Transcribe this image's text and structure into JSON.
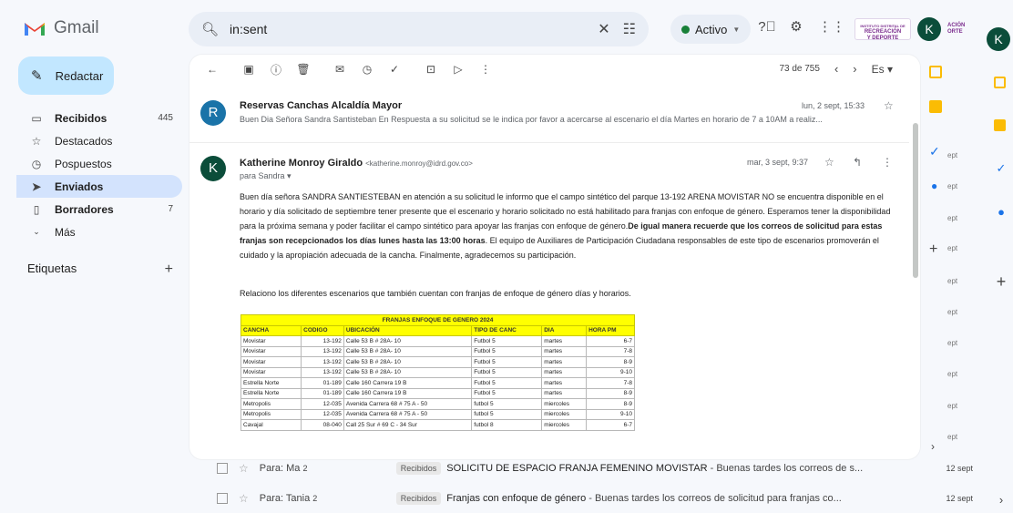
{
  "app": {
    "name": "Gmail"
  },
  "search": {
    "query": "in:sent"
  },
  "status": {
    "label": "Activo"
  },
  "org_logo": {
    "line1": "INSTITUTO DISTRITAL DE",
    "line2": "RECREACIÓN",
    "line3": "Y DEPORTE",
    "line3b": "ACIÓN",
    "line3c": "ORTE"
  },
  "account": {
    "initial": "K"
  },
  "compose": {
    "label": "Redactar"
  },
  "sidebar": {
    "items": [
      {
        "label": "Recibidos",
        "count": "445"
      },
      {
        "label": "Destacados",
        "count": ""
      },
      {
        "label": "Pospuestos",
        "count": ""
      },
      {
        "label": "Enviados",
        "count": ""
      },
      {
        "label": "Borradores",
        "count": "7"
      },
      {
        "label": "Más",
        "count": ""
      }
    ],
    "labels_title": "Etiquetas"
  },
  "toolbar": {
    "pager": "73 de 755",
    "lang": "Es"
  },
  "messages": [
    {
      "avatar": "R",
      "sender": "Reservas Canchas Alcaldía Mayor",
      "date": "lun, 2 sept, 15:33",
      "snippet": "Buen Dia Señora Sandra Santisteban En Respuesta a su solicitud se le indica por favor a acercarse al escenario el día Martes en horario de 7 a 10AM a realiz..."
    },
    {
      "avatar": "K",
      "sender": "Katherine Monroy Giraldo",
      "address": "<katherine.monroy@idrd.gov.co>",
      "to": "para Sandra",
      "date": "mar, 3 sept, 9:37"
    }
  ],
  "body": {
    "p1a": "Buen día señora SANDRA SANTIESTEBAN en atención a su solicitud le informo que el campo sintético del parque 13-192  ARENA MOVISTAR  NO se encuentra disponible en el horario y día solicitado de septiembre tener presente que el escenario y horario solicitado no está habilitado para  franjas con enfoque de género.   Esperamos tener la disponibilidad para la próxima semana y poder  facilitar el campo sintético  para apoyar  las franjas con enfoque de género.",
    "p1b": "De igual manera recuerde  que los correos de solicitud para estas franjas son recepcionados los días lunes hasta las 13:00 horas",
    "p1c": ". El equipo de Auxiliares de Participación Ciudadana responsables de este tipo de escenarios  promoverán el cuidado y la apropiación adecuada de la cancha. Finalmente, agradecemos su participación.",
    "p2": "Relaciono los diferentes escenarios que también cuentan con franjas de enfoque de género  días y horarios."
  },
  "table": {
    "title": "FRANJAS ENFOQUE DE GENERO 2024",
    "headers": [
      "CANCHA",
      "CODIGO",
      "UBICACIÓN",
      "TIPO DE CANC",
      "DIA",
      "HORA PM"
    ],
    "rows": [
      [
        "Movistar",
        "13-192",
        "Calle 53 B # 28A- 10",
        "Futbol 5",
        "martes",
        "6-7"
      ],
      [
        "Movistar",
        "13-192",
        "Calle 53 B # 28A- 10",
        "Futbol 5",
        "martes",
        "7-8"
      ],
      [
        "Movistar",
        "13-192",
        "Calle 53 B # 28A- 10",
        "Futbol 5",
        "martes",
        "8-9"
      ],
      [
        "Movistar",
        "13-192",
        "Calle 53 B # 28A- 10",
        "Futbol 5",
        "martes",
        "9-10"
      ],
      [
        "Estrella Norte",
        "01-189",
        "Calle 160 Carrera 19 B",
        "Futbol 5",
        "martes",
        "7-8"
      ],
      [
        "Estrella Norte",
        "01-189",
        "Calle 160 Carrera 19 B",
        "Futbol 5",
        "martes",
        "8-9"
      ],
      [
        "Metropolis",
        "12-035",
        "Avenida Carrera 68 # 75 A - 50",
        "futbol 5",
        "miercoles",
        "8-9"
      ],
      [
        "Metropolis",
        "12-035",
        "Avenida Carrera 68 # 75 A - 50",
        "futbol 5",
        "miercoles",
        "9-10"
      ],
      [
        "Cavajal",
        "08-040",
        "Call 25 Sur # 69 C - 34 Sur",
        "futbol 8",
        "miercoles",
        "6-7"
      ]
    ]
  },
  "list_rows": [
    {
      "to": "Para: Ma",
      "count": "2",
      "tag": "Recibidos",
      "subject": "SOLICITU DE ESPACIO FRANJA FEMENINO MOVISTAR",
      "snippet": "Buenas tardes los correos de s...",
      "date": "12 sept"
    },
    {
      "to": "Para: Tania",
      "count": "2",
      "tag": "Recibidos",
      "subject": "Franjas con enfoque de género",
      "snippet": "Buenas tardes los correos de solicitud para franjas co...",
      "date": "12 sept"
    }
  ],
  "right_dates": [
    "ept",
    "ept",
    "ept",
    "ept",
    "ept",
    "ept",
    "ept",
    "ept",
    "ept",
    "ept"
  ],
  "colors": {
    "compose_bg": "#c2e7ff",
    "active_nav": "#d3e3fd",
    "avatar_k": "#0b4d3a",
    "avatar_r": "#1a73a8",
    "sheet_header": "#ffff00"
  }
}
